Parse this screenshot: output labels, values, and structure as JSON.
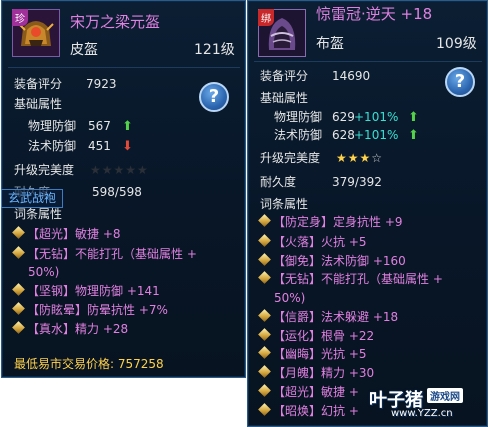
{
  "left": {
    "badge": "珍",
    "item_name": "宋万之梁元盔",
    "item_type": "皮盔",
    "level": "121级",
    "score_label": "装备评分",
    "score": "7923",
    "base_attr_title": "基础属性",
    "phys_def_label": "物理防御",
    "phys_def": "567",
    "mag_def_label": "法术防御",
    "mag_def": "451",
    "perfection_label": "升级完美度",
    "stars": "★★★★★",
    "durability_label": "耐久度",
    "durability": "598/598",
    "overlay_label": "玄武战袍",
    "affix_title": "词条属性",
    "affixes": [
      {
        "tag": "【超光】",
        "text": "敏捷 +8"
      },
      {
        "tag": "【无钻】",
        "text": "不能打孔（基础属性 +"
      },
      {
        "tag": "",
        "text": "50%)"
      },
      {
        "tag": "【坚钢】",
        "text": "物理防御 +141"
      },
      {
        "tag": "【防眩晕】",
        "text": "防晕抗性 +7%"
      },
      {
        "tag": "【真水】",
        "text": "精力 +28"
      }
    ],
    "market_price": "最低易市交易价格: 757258"
  },
  "right": {
    "badge": "绑",
    "item_name": "惊雷冠·逆天 +18",
    "item_type": "布盔",
    "level": "109级",
    "score_label": "装备评分",
    "score": "14690",
    "base_attr_title": "基础属性",
    "phys_def_label": "物理防御",
    "phys_def": "629",
    "phys_bonus": "+101%",
    "mag_def_label": "法术防御",
    "mag_def": "628",
    "mag_bonus": "+101%",
    "perfection_label": "升级完美度",
    "stars_filled": "★★★",
    "stars_empty": "☆",
    "durability_label": "耐久度",
    "durability": "379/392",
    "affix_title": "词条属性",
    "affixes": [
      {
        "tag": "【防定身】",
        "text": "定身抗性 +9"
      },
      {
        "tag": "【火落】",
        "text": "火抗 +5"
      },
      {
        "tag": "【御免】",
        "text": "法术防御 +160"
      },
      {
        "tag": "【无钻】",
        "text": "不能打孔（基础属性 +"
      },
      {
        "tag": "",
        "text": "50%)"
      },
      {
        "tag": "【信爵】",
        "text": "法术躲避 +18"
      },
      {
        "tag": "【运化】",
        "text": "根骨 +22"
      },
      {
        "tag": "【幽晦】",
        "text": "光抗 +5"
      },
      {
        "tag": "【月魄】",
        "text": "精力 +30"
      },
      {
        "tag": "【超光】",
        "text": "敏捷 +"
      },
      {
        "tag": "【昭焕】",
        "text": "幻抗 +"
      }
    ]
  },
  "help_label": "?",
  "watermark": {
    "name": "叶子猪",
    "tag": "游戏网",
    "url": "www.YZZ.cn"
  }
}
